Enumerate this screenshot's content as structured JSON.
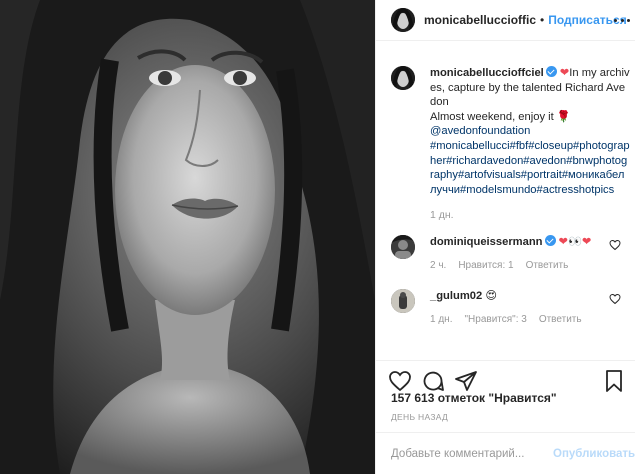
{
  "post": {
    "image_alt": "Black and white portrait photograph"
  },
  "header": {
    "username": "monicabelluccioffic",
    "separator": "•",
    "follow_label": "Подписаться",
    "more_icon": "more-dots-icon"
  },
  "caption": {
    "username": "monicabelluccioffciel",
    "heart": "❤",
    "text_1": "In my archives, capture by the talented Richard Avedon",
    "text_2": "Almost weekend, enjoy it",
    "rose": "🌹",
    "mention": "@avedonfoundation",
    "hashtags": "#monicabellucci#fbf#closeup#photographer#richardavedon#avedon#bnwphotography#artofvisuals#portrait#моникабеллуччи#modelsmundo#actresshotpics",
    "time": "1 дн."
  },
  "comments": [
    {
      "username": "dominiqueissermann",
      "text": "❤👀❤",
      "time": "2 ч.",
      "likes": "Нравится: 1",
      "reply": "Ответить"
    },
    {
      "username": "_gulum02",
      "text": "😍",
      "time": "1 дн.",
      "likes": "\"Нравится\": 3",
      "reply": "Ответить"
    }
  ],
  "actions": {
    "like_icon": "heart-icon",
    "comment_icon": "comment-icon",
    "share_icon": "share-icon",
    "save_icon": "bookmark-icon"
  },
  "likes_text": "157 613 отметок \"Нравится\"",
  "date_text": "ДЕНЬ НАЗАД",
  "add_comment": {
    "placeholder": "Добавьте комментарий...",
    "publish_label": "Опубликовать"
  },
  "colors": {
    "accent": "#3897f0",
    "heart": "#ed4956",
    "tag": "#003569",
    "muted": "#999999"
  }
}
